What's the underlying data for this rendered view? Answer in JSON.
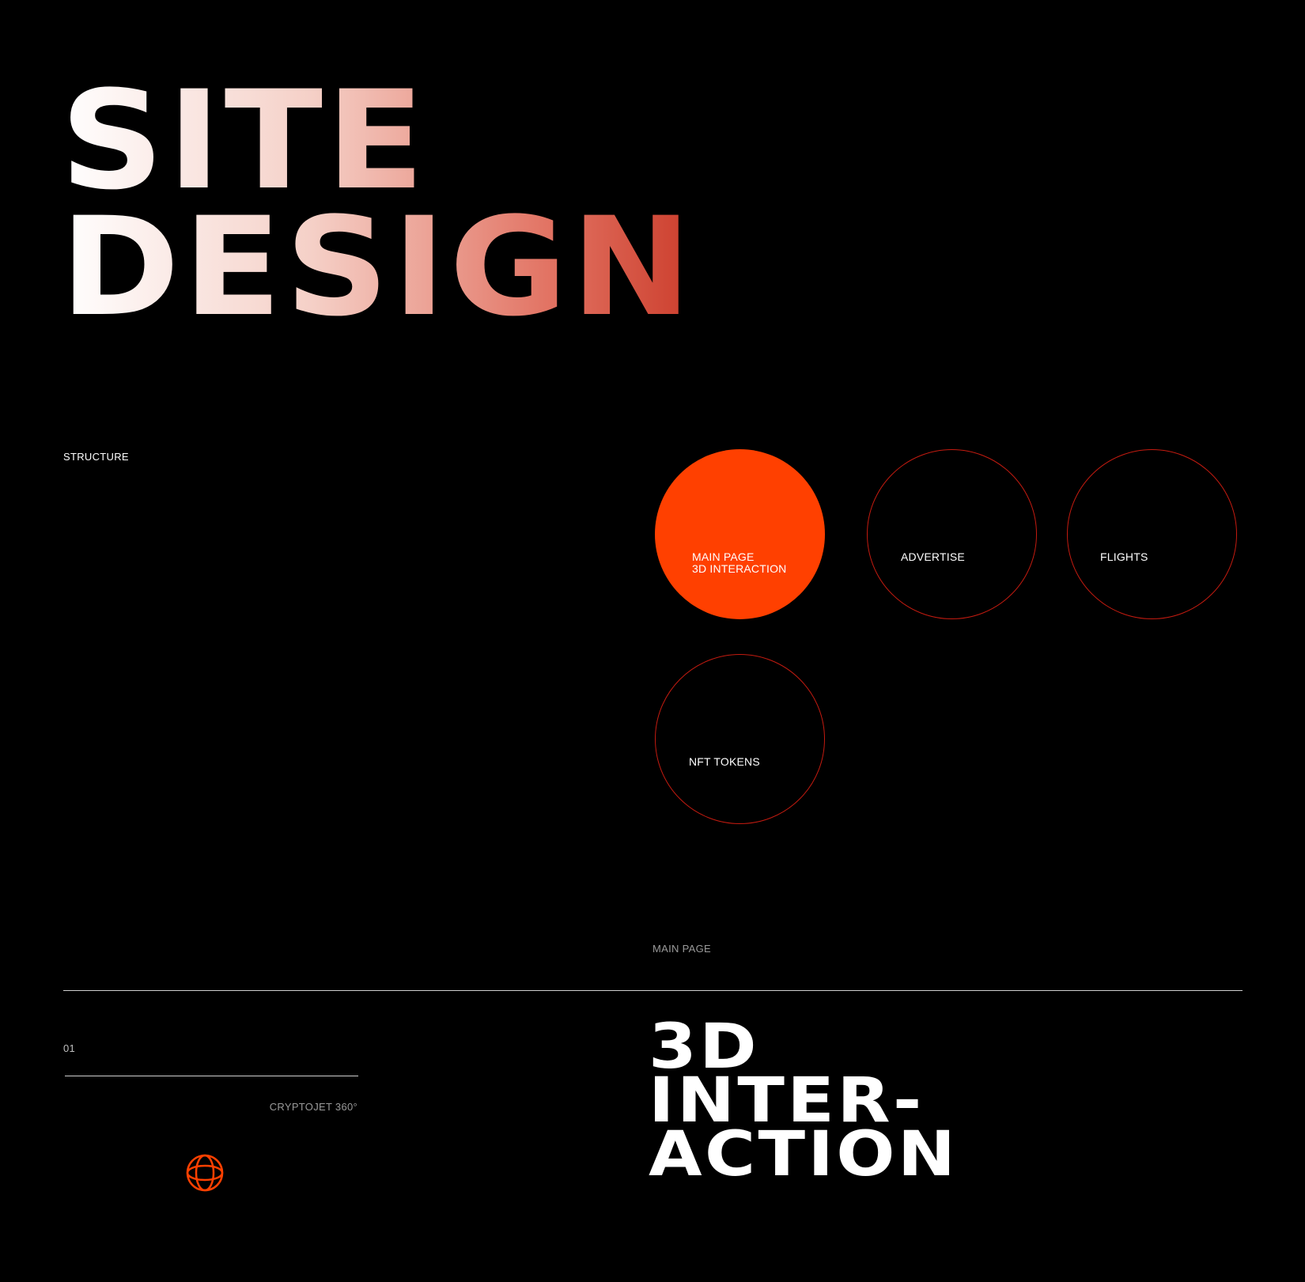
{
  "hero": {
    "line1": "SITE",
    "line2": "DESIGN"
  },
  "structure": {
    "label": "STRUCTURE",
    "nodes": [
      {
        "label": "MAIN PAGE\n3D INTERACTION",
        "active": true
      },
      {
        "label": "ADVERTISE",
        "active": false
      },
      {
        "label": "FLIGHTS",
        "active": false
      },
      {
        "label": "NFT TOKENS",
        "active": false
      }
    ],
    "caption": "MAIN PAGE"
  },
  "footer": {
    "index": "01",
    "brand": "CRYPTOJET 360°",
    "logo_icon": "globe-icon",
    "heading": "3D\nINTER-\nACTION"
  },
  "colors": {
    "background": "#000000",
    "accent": "#ff4000",
    "outline": "#c41b10",
    "gradient_start": "#ffffff",
    "gradient_end": "#b80f00"
  }
}
